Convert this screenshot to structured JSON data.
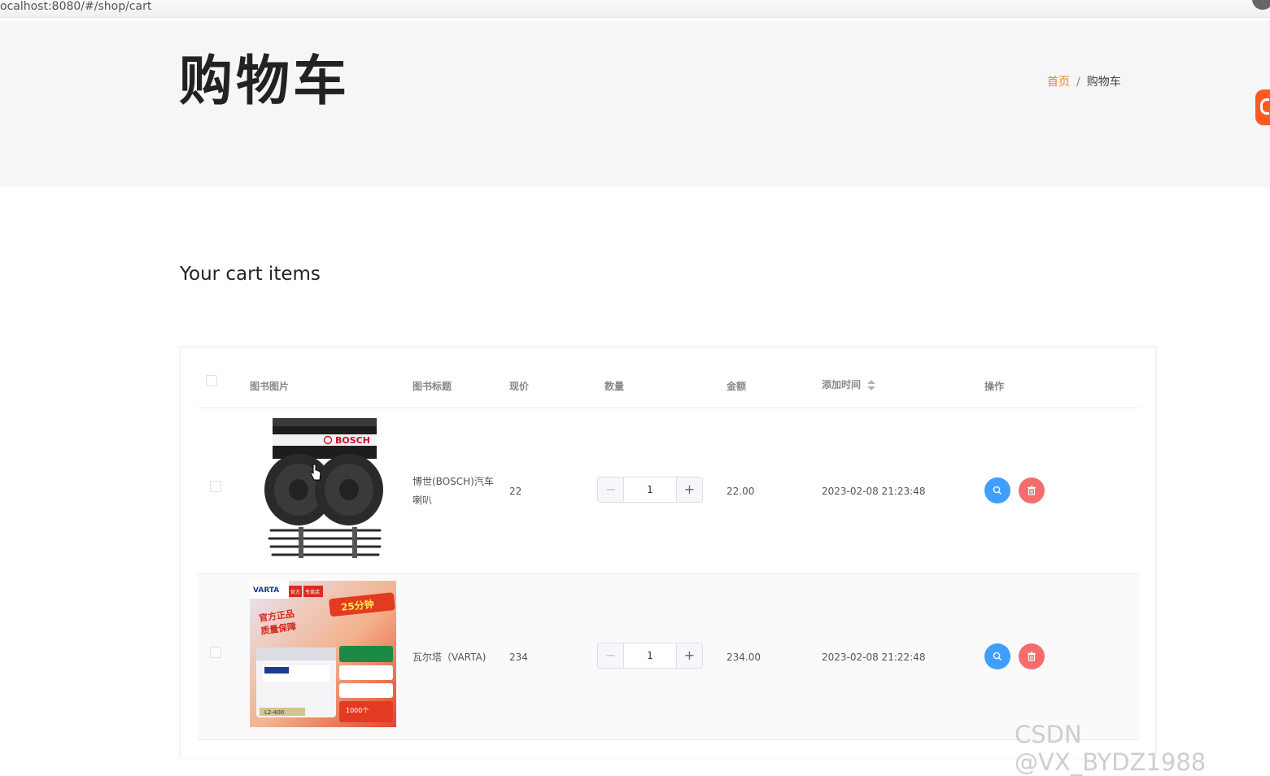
{
  "browser": {
    "url": "ocalhost:8080/#/shop/cart"
  },
  "hero": {
    "title": "购物车",
    "breadcrumb": {
      "home": "首页",
      "separator": "/",
      "current": "购物车"
    }
  },
  "section": {
    "title": "Your cart items"
  },
  "table": {
    "headers": {
      "image": "图书图片",
      "title": "图书标题",
      "price": "现价",
      "quantity": "数量",
      "amount": "金额",
      "added_time": "添加时间",
      "actions": "操作"
    },
    "rows": [
      {
        "image_icon": "bosch-horn-product-image",
        "title": "博世(BOSCH)汽车喇叭",
        "price": "22",
        "quantity": "1",
        "amount": "22.00",
        "added_time": "2023-02-08 21:23:48"
      },
      {
        "image_icon": "varta-battery-product-image",
        "title": "瓦尔塔（VARTA)",
        "price": "234",
        "quantity": "1",
        "amount": "234.00",
        "added_time": "2023-02-08 21:22:48"
      }
    ]
  },
  "stepper": {
    "minus": "−",
    "plus": "+"
  },
  "image_text": {
    "bosch_brand": "BOSCH",
    "varta_brand": "VARTA",
    "varta_store_a": "官方",
    "varta_store_b": "专卖店",
    "varta_slogan_1": "官方正品",
    "varta_slogan_2": "质量保障",
    "varta_delivery": "25分钟",
    "varta_model": "L2-400",
    "varta_promo": "1000个"
  },
  "watermark": "CSDN @VX_BYDZ1988",
  "colors": {
    "accent": "#e6862a",
    "view_button": "#409eff",
    "delete_button": "#f56c6c",
    "hero_background": "#f6f6f8"
  }
}
